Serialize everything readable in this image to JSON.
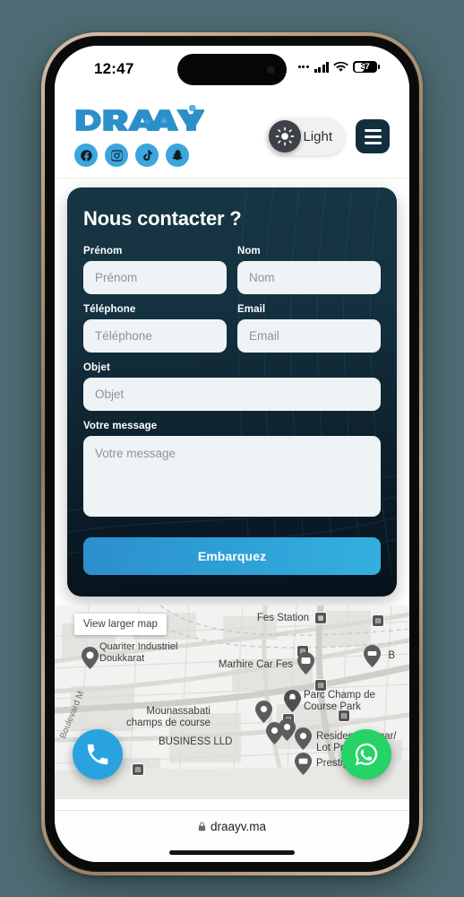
{
  "status_bar": {
    "time": "12:47",
    "battery_level": "37",
    "signal_icon": "cellular-signal-icon",
    "wifi_icon": "wifi-icon",
    "battery_icon": "battery-icon"
  },
  "header": {
    "logo_text": "DRAAYV",
    "socials": [
      {
        "name": "facebook",
        "label": "Facebook"
      },
      {
        "name": "instagram",
        "label": "Instagram"
      },
      {
        "name": "tiktok",
        "label": "TikTok"
      },
      {
        "name": "snapchat",
        "label": "Snapchat"
      }
    ],
    "theme_toggle_label": "Light",
    "theme_icon": "sun-icon",
    "menu_icon": "hamburger-menu-icon"
  },
  "contact_form": {
    "title": "Nous contacter ?",
    "fields": [
      {
        "label": "Prénom",
        "placeholder": "Prénom",
        "value": ""
      },
      {
        "label": "Nom",
        "placeholder": "Nom",
        "value": ""
      },
      {
        "label": "Téléphone",
        "placeholder": "Téléphone",
        "value": ""
      },
      {
        "label": "Email",
        "placeholder": "Email",
        "value": ""
      },
      {
        "label": "Objet",
        "placeholder": "Objet",
        "value": ""
      },
      {
        "label": "Votre message",
        "placeholder": "Votre message",
        "value": ""
      }
    ],
    "submit_label": "Embarquez",
    "accent_color": "#2e9ed6",
    "card_color": "#143140"
  },
  "map": {
    "view_larger_label": "View larger map",
    "labels": [
      "Quariter Industriel\nDoukkarat",
      "Fes Station",
      "Marhire Car Fes",
      "Parc Champ de\nCourse Park",
      "Mounassabati\nchamps de course",
      "BUSINESS LLD",
      "Residence Omar/\nLot Prestigia",
      "Prestigia Fes",
      "B",
      "Boulevard M"
    ],
    "call_button_icon": "phone-icon",
    "whatsapp_button_icon": "whatsapp-icon",
    "call_button_color": "#29a3e0",
    "whatsapp_button_color": "#25d366"
  },
  "browser": {
    "url": "draayv.ma",
    "lock_icon": "lock-icon"
  }
}
